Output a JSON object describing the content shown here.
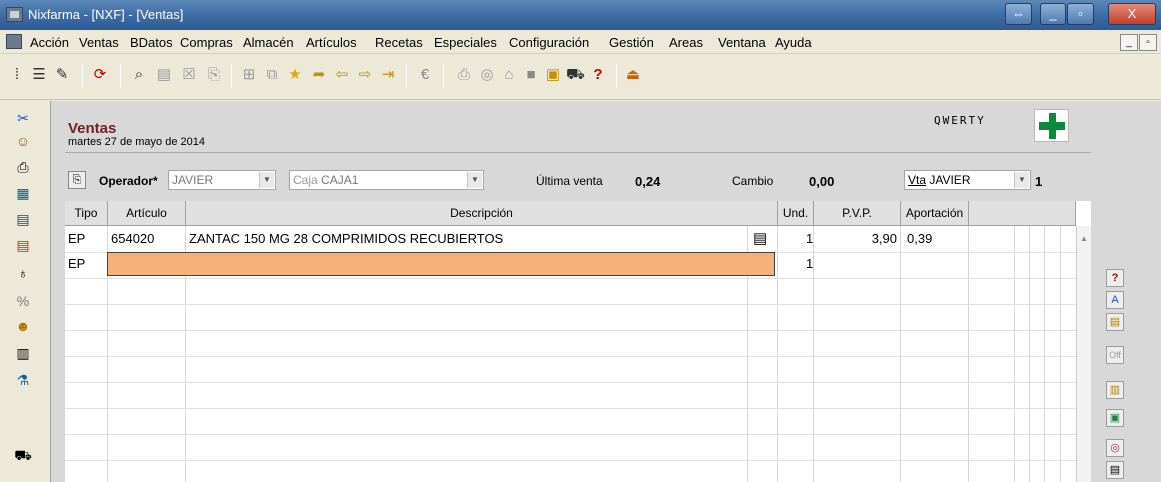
{
  "window": {
    "title": "Nixfarma - [NXF] - [Ventas]"
  },
  "menu": [
    "Acción",
    "Ventas",
    "BDatos",
    "Compras",
    "Almacén",
    "Artículos",
    "Recetas",
    "Especiales",
    "Configuración",
    "Gestión",
    "Areas",
    "Ventana",
    "Ayuda"
  ],
  "header": {
    "title": "Ventas",
    "date": "martes 27 de mayo de 2014",
    "keyboard": "QWERTY"
  },
  "controls": {
    "operador_label": "Operador*",
    "operador_value": "JAVIER",
    "caja_label": "Caja",
    "caja_value": "CAJA1",
    "ultima_label": "Última venta",
    "ultima_value": "0,24",
    "cambio_label": "Cambio",
    "cambio_value": "0,00",
    "vta_label": "Vta",
    "vta_value": "JAVIER",
    "vta_number": "1"
  },
  "table": {
    "columns": [
      "Tipo",
      "Artículo",
      "Descripción",
      "Und.",
      "P.V.P.",
      "Aportación"
    ],
    "rows": [
      {
        "tipo": "EP",
        "articulo": "654020",
        "descripcion": "ZANTAC 150 MG 28 COMPRIMIDOS RECUBIERTOS",
        "und": "1",
        "pvp": "3,90",
        "aportacion": "0,39"
      },
      {
        "tipo": "EP",
        "articulo": "",
        "descripcion": "",
        "und": "1",
        "pvp": "",
        "aportacion": ""
      }
    ]
  },
  "colors": {
    "title_bar": "#2d5b94",
    "form_title": "#732020",
    "edit_row": "#f6b07a",
    "logo_cross": "#0c8a3c"
  }
}
